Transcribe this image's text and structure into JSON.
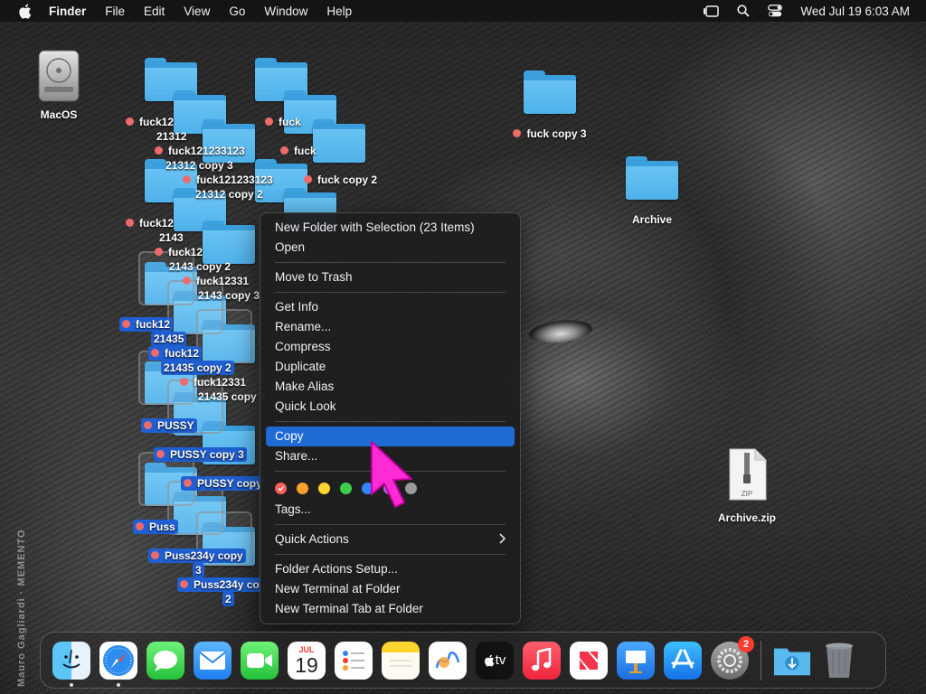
{
  "menubar": {
    "app_name": "Finder",
    "items": [
      "File",
      "Edit",
      "View",
      "Go",
      "Window",
      "Help"
    ],
    "clock": "Wed Jul 19  6:03 AM"
  },
  "desktop": {
    "right_items": [
      {
        "label": "MacOS"
      },
      {
        "label": "fuck copy 3"
      },
      {
        "label": "Archive"
      },
      {
        "label": "Archive.zip",
        "file_kind": "ZIP"
      }
    ],
    "folder_labels": [
      "fuck12",
      "21312",
      "fuck121233123",
      "21312 copy 3",
      "fuck121233123",
      "21312 copy 2",
      "fuck",
      "fuck",
      "fuck copy 2",
      "fuck12",
      "2143",
      "fuck12",
      "2143 copy 2",
      "fuck12331",
      "2143 copy 3",
      "fuck12",
      "21435",
      "fuck12",
      "21435 copy 2",
      "fuck12331",
      "21435 copy 3",
      "PUSSY",
      "PUSSY copy 3",
      "PUSSY copy",
      "Puss",
      "Puss234y copy",
      "3",
      "Puss234y co",
      "2"
    ],
    "side_text": "Mauro Gagliardi · MEMENTO"
  },
  "context_menu": {
    "groups": [
      [
        "New Folder with Selection (23 Items)",
        "Open"
      ],
      [
        "Move to Trash"
      ],
      [
        "Get Info",
        "Rename...",
        "Compress",
        "Duplicate",
        "Make Alias",
        "Quick Look"
      ],
      [
        "Copy",
        "Share..."
      ],
      [
        "Tags..."
      ],
      [
        "Quick Actions"
      ],
      [
        "Folder Actions Setup...",
        "New Terminal at Folder",
        "New Terminal Tab at Folder"
      ]
    ],
    "highlighted": "Copy",
    "tag_colors": [
      "#ff5f57",
      "#ff9f2d",
      "#ffd52e",
      "#3ecf4a",
      "#2f86ff",
      "#b05fd8",
      "#9a9a9a"
    ]
  },
  "dock": {
    "apps": [
      {
        "name": "Finder",
        "icon": "finder-icon",
        "running": true
      },
      {
        "name": "Safari",
        "icon": "safari-icon",
        "running": true
      },
      {
        "name": "Messages",
        "icon": "messages-icon"
      },
      {
        "name": "Mail",
        "icon": "mail-icon"
      },
      {
        "name": "FaceTime",
        "icon": "facetime-icon"
      },
      {
        "name": "Calendar",
        "icon": "calendar-icon",
        "month": "JUL",
        "day": "19"
      },
      {
        "name": "Reminders",
        "icon": "reminders-icon"
      },
      {
        "name": "Notes",
        "icon": "notes-icon"
      },
      {
        "name": "Freeform",
        "icon": "freeform-icon"
      },
      {
        "name": "TV",
        "icon": "tv-icon",
        "text": "tv"
      },
      {
        "name": "Music",
        "icon": "music-icon"
      },
      {
        "name": "News",
        "icon": "news-icon"
      },
      {
        "name": "Keynote",
        "icon": "keynote-icon"
      },
      {
        "name": "App Store",
        "icon": "app-store-icon"
      },
      {
        "name": "System Settings",
        "icon": "system-settings-icon",
        "badge": "2"
      },
      {
        "name": "Downloads",
        "icon": "downloads-folder-icon"
      },
      {
        "name": "Trash",
        "icon": "trash-icon"
      }
    ]
  }
}
